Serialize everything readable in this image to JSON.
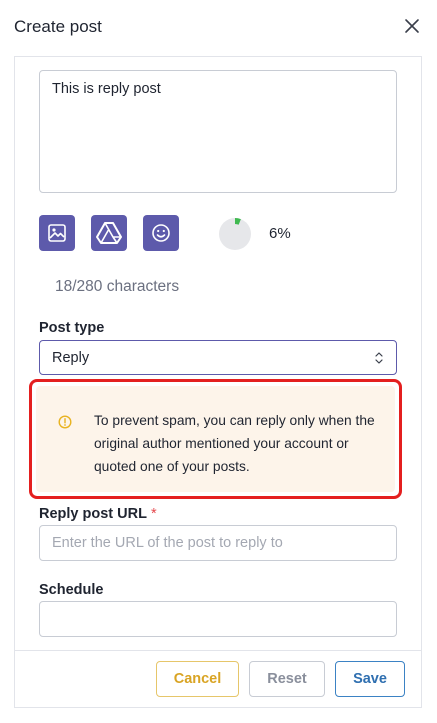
{
  "dialog": {
    "title": "Create post"
  },
  "editor": {
    "content": "This is reply post",
    "progress_percent_value": 6,
    "progress_percent_label": "6%",
    "char_count": "18/280 characters"
  },
  "post_type": {
    "label": "Post type",
    "selected": "Reply"
  },
  "alert": {
    "message": "To prevent spam, you can reply only when the original author mentioned your account or quoted one of your posts."
  },
  "reply_url": {
    "label": "Reply post URL",
    "required_mark": "*",
    "placeholder": "Enter the URL of the post to reply to",
    "value": ""
  },
  "schedule": {
    "label": "Schedule",
    "value": ""
  },
  "footer": {
    "cancel_label": "Cancel",
    "reset_label": "Reset",
    "save_label": "Save"
  },
  "colors": {
    "accent": "#5d5aab",
    "highlight_border": "#e41f1f",
    "alert_bg": "#fdf4ea",
    "warning": "#e8b21f",
    "progress": "#3fb950"
  },
  "icons": [
    "close-icon",
    "image-icon",
    "drive-icon",
    "emoji-icon",
    "warning-icon",
    "select-chevron-icon"
  ]
}
